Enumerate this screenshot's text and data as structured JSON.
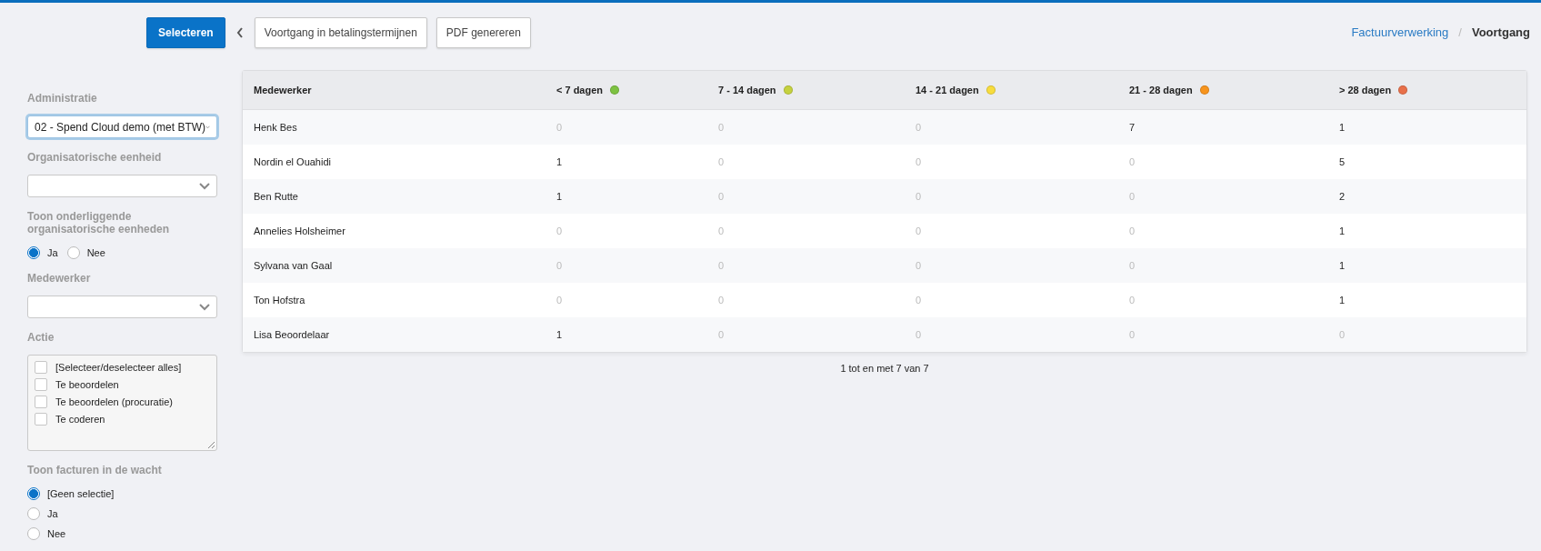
{
  "toolbar": {
    "primary_button": "Selecteren",
    "buttons": [
      "Voortgang in betalingstermijnen",
      "PDF genereren"
    ]
  },
  "breadcrumb": {
    "items": [
      "Factuurverwerking",
      "Voortgang"
    ],
    "separator": "/"
  },
  "filters": [
    {
      "kind": "select",
      "label": "Administratie",
      "value": "02 - Spend Cloud demo (met BTW)",
      "focused": true
    },
    {
      "kind": "select",
      "label": "Organisatorische eenheid",
      "focused": false
    },
    {
      "kind": "radio_row",
      "label": "Toon onderliggende organisatorische eenheden",
      "options": [
        {
          "label": "Ja",
          "selected": true
        },
        {
          "label": "Nee",
          "selected": false
        }
      ]
    },
    {
      "kind": "select",
      "label": "Medewerker",
      "focused": false
    },
    {
      "kind": "checklist",
      "label": "Actie",
      "options": [
        {
          "label": "[Selecteer/deselecteer alles]",
          "checked": false
        },
        {
          "label": "Te beoordelen",
          "checked": false
        },
        {
          "label": "Te beoordelen (procuratie)",
          "checked": false
        },
        {
          "label": "Te coderen",
          "checked": false
        }
      ]
    },
    {
      "kind": "radio",
      "label": "Toon facturen in de wacht",
      "options": [
        {
          "label": "[Geen selectie]",
          "selected": true
        },
        {
          "label": "Ja",
          "selected": false
        },
        {
          "label": "Nee",
          "selected": false
        }
      ]
    }
  ],
  "table": {
    "columns": [
      {
        "label": "Medewerker"
      },
      {
        "label": "< 7 dagen",
        "color": "#7dc242"
      },
      {
        "label": "7 - 14 dagen",
        "color": "#c5d13f"
      },
      {
        "label": "14 - 21 dagen",
        "color": "#f7dc3e"
      },
      {
        "label": "21 - 28 dagen",
        "color": "#f7941d"
      },
      {
        "label": "> 28 dagen",
        "color": "#e8704a"
      }
    ],
    "rows": [
      {
        "cells": [
          {
            "text": "Henk Bes",
            "muted": false
          },
          {
            "text": "0",
            "muted": true
          },
          {
            "text": "0",
            "muted": true
          },
          {
            "text": "0",
            "muted": true
          },
          {
            "text": "7",
            "muted": false
          },
          {
            "text": "1",
            "muted": false
          }
        ]
      },
      {
        "cells": [
          {
            "text": "Nordin el Ouahidi",
            "muted": false
          },
          {
            "text": "1",
            "muted": false
          },
          {
            "text": "0",
            "muted": true
          },
          {
            "text": "0",
            "muted": true
          },
          {
            "text": "0",
            "muted": true
          },
          {
            "text": "5",
            "muted": false
          }
        ]
      },
      {
        "cells": [
          {
            "text": "Ben Rutte",
            "muted": false
          },
          {
            "text": "1",
            "muted": false
          },
          {
            "text": "0",
            "muted": true
          },
          {
            "text": "0",
            "muted": true
          },
          {
            "text": "0",
            "muted": true
          },
          {
            "text": "2",
            "muted": false
          }
        ]
      },
      {
        "cells": [
          {
            "text": "Annelies Holsheimer",
            "muted": false
          },
          {
            "text": "0",
            "muted": true
          },
          {
            "text": "0",
            "muted": true
          },
          {
            "text": "0",
            "muted": true
          },
          {
            "text": "0",
            "muted": true
          },
          {
            "text": "1",
            "muted": false
          }
        ]
      },
      {
        "cells": [
          {
            "text": "Sylvana van Gaal",
            "muted": false
          },
          {
            "text": "0",
            "muted": true
          },
          {
            "text": "0",
            "muted": true
          },
          {
            "text": "0",
            "muted": true
          },
          {
            "text": "0",
            "muted": true
          },
          {
            "text": "1",
            "muted": false
          }
        ]
      },
      {
        "cells": [
          {
            "text": "Ton Hofstra",
            "muted": false
          },
          {
            "text": "0",
            "muted": true
          },
          {
            "text": "0",
            "muted": true
          },
          {
            "text": "0",
            "muted": true
          },
          {
            "text": "0",
            "muted": true
          },
          {
            "text": "1",
            "muted": false
          }
        ]
      },
      {
        "cells": [
          {
            "text": "Lisa Beoordelaar",
            "muted": false
          },
          {
            "text": "1",
            "muted": false
          },
          {
            "text": "0",
            "muted": true
          },
          {
            "text": "0",
            "muted": true
          },
          {
            "text": "0",
            "muted": true
          },
          {
            "text": "0",
            "muted": true
          }
        ]
      }
    ],
    "footer": "1 tot en met 7 van 7"
  }
}
